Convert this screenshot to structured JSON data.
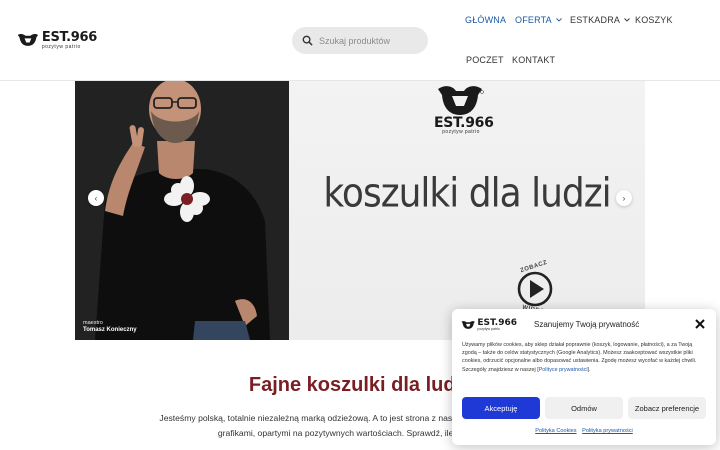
{
  "header": {
    "logo_text": "EST.966",
    "logo_subtitle": "pozytyw patrio",
    "search_placeholder": "Szukaj produktów",
    "nav": [
      {
        "label": "GŁÓWNA",
        "active": true
      },
      {
        "label": "OFERTA",
        "has_dropdown": true
      },
      {
        "label": "ESTKADRA",
        "has_dropdown": true
      },
      {
        "label": "KOSZYK"
      },
      {
        "label": "POCZET"
      },
      {
        "label": "KONTAKT"
      }
    ]
  },
  "hero": {
    "brand_text": "EST.966",
    "brand_subtitle": "pozytyw patrio",
    "title": "koszulki dla ludzi",
    "caption_role": "maestro",
    "caption_name": "Tomasz Konieczny",
    "play_text_top": "ZOBACZ",
    "play_text_bottom": "WIDEO",
    "prev_arrow": "‹",
    "next_arrow": "›"
  },
  "main": {
    "heading": "Fajne koszulki dla ludzi",
    "intro_line1": "Jesteśmy polską, totalnie niezależną marką odzieżową. A to jest strona z naszymi wyjątkowymi ubraniami",
    "intro_line2": "grafikami, opartymi na pozytywnych wartościach. Sprawdź, ile fajnych emo"
  },
  "cookie_dialog": {
    "logo_text": "EST.966",
    "logo_subtitle": "pozytyw patrio",
    "title": "Szanujemy Twoją prywatność",
    "body": "Używamy plików cookies, aby sklep działał poprawnie (koszyk, logowanie, płatności), a za Twoją zgodą – także do celów statystycznych (Google Analytics). Możesz zaakceptować wszystkie pliki cookies, odrzucić opcjonalne albo dopasować ustawienia. Zgodę możesz wycofać w każdej chwili. Szczegóły znajdziesz w naszej [",
    "body_link": "Polityce prywatności",
    "body_end": "].",
    "accept_label": "Akceptuję",
    "deny_label": "Odmów",
    "prefs_label": "Zobacz preferencje",
    "link_cookies": "Polityka Cookies",
    "link_privacy": "Polityka prywatności"
  },
  "colors": {
    "accent": "#1c5aa6",
    "heading": "#7a1e24",
    "accept_button": "#1f39d6"
  }
}
